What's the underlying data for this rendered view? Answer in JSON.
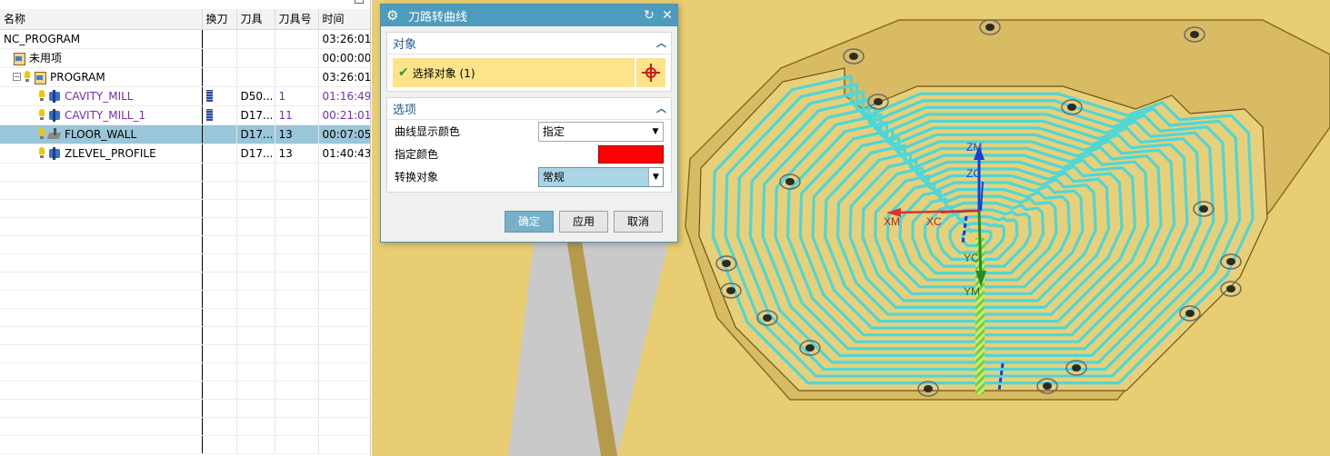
{
  "navigator": {
    "columns": [
      "名称",
      "换刀",
      "刀具",
      "刀具号",
      "时间"
    ],
    "rows": [
      {
        "name": "NC_PROGRAM",
        "tool": "",
        "tool_no": "",
        "time": "03:26:01",
        "level": 0,
        "icon": "none",
        "purple": false
      },
      {
        "name": "未用项",
        "tool": "",
        "tool_no": "",
        "time": "00:00:00",
        "level": 1,
        "icon": "program-icon",
        "purple": false
      },
      {
        "name": "PROGRAM",
        "tool": "",
        "tool_no": "",
        "time": "03:26:01",
        "level": 1,
        "icon": "program-icon",
        "purple": false,
        "expanded": true
      },
      {
        "name": "CAVITY_MILL",
        "tool": "D50...",
        "tool_no": "1",
        "time": "01:16:49",
        "level": 2,
        "icon": "cavity-mill-icon",
        "purple": true,
        "tool_change": true
      },
      {
        "name": "CAVITY_MILL_1",
        "tool": "D17...",
        "tool_no": "11",
        "time": "00:21:01",
        "level": 2,
        "icon": "cavity-mill-icon",
        "purple": true,
        "tool_change": true
      },
      {
        "name": "FLOOR_WALL",
        "tool": "D17...",
        "tool_no": "13",
        "time": "00:07:05",
        "level": 2,
        "icon": "floor-wall-icon",
        "purple": false,
        "selected": true
      },
      {
        "name": "ZLEVEL_PROFILE",
        "tool": "D17...",
        "tool_no": "13",
        "time": "01:40:43",
        "level": 2,
        "icon": "zlevel-profile-icon",
        "purple": false
      }
    ],
    "empty_rows": 16
  },
  "dialog": {
    "title": "刀路转曲线",
    "group_object": "对象",
    "select_label": "选择对象 (1)",
    "group_options": "选项",
    "curve_color_label": "曲线显示颜色",
    "curve_color_value": "指定",
    "specify_color_label": "指定颜色",
    "specify_color_hex": "#ff0000",
    "convert_label": "转换对象",
    "convert_value": "常规",
    "ok": "确定",
    "apply": "应用",
    "cancel": "取消"
  },
  "viewport": {
    "axis_labels": {
      "zm": "ZM",
      "zc": "ZC",
      "xm": "XM",
      "xc": "XC",
      "yc": "YC",
      "ym": "YM"
    },
    "colors": {
      "background": "#e9cd72",
      "part": "#e6c97a",
      "toolpath": "#4fd6d6",
      "wall": "#b89a3e"
    }
  }
}
